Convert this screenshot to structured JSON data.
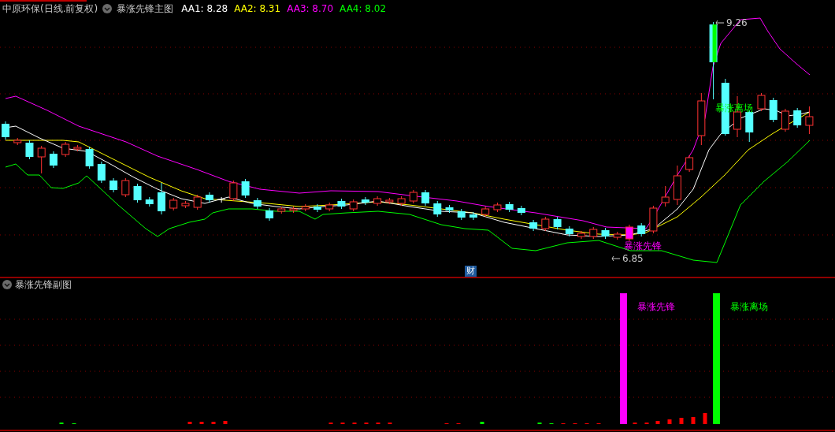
{
  "header": {
    "stock": "中原环保(日线.前复权)",
    "indicator": "暴涨先锋主图",
    "values": [
      {
        "label": "AA1: 8.28",
        "color": "#ffffff"
      },
      {
        "label": "AA2: 8.31",
        "color": "#ffff00"
      },
      {
        "label": "AA3: 8.70",
        "color": "#ff00ff"
      },
      {
        "label": "AA4: 8.02",
        "color": "#00ff00"
      }
    ]
  },
  "main_chart": {
    "markers": [
      {
        "kind": "high",
        "text": "9.26"
      },
      {
        "kind": "low",
        "text": "6.85"
      }
    ],
    "signals": [
      {
        "kind": "entry",
        "text": "暴涨先锋"
      },
      {
        "kind": "exit",
        "text": "暴涨离场"
      }
    ],
    "event_badge": "财"
  },
  "sub_chart": {
    "title": "暴涨先锋副图",
    "signals": [
      {
        "kind": "entry",
        "text": "暴涨先锋"
      },
      {
        "kind": "exit",
        "text": "暴涨离场"
      }
    ]
  }
}
